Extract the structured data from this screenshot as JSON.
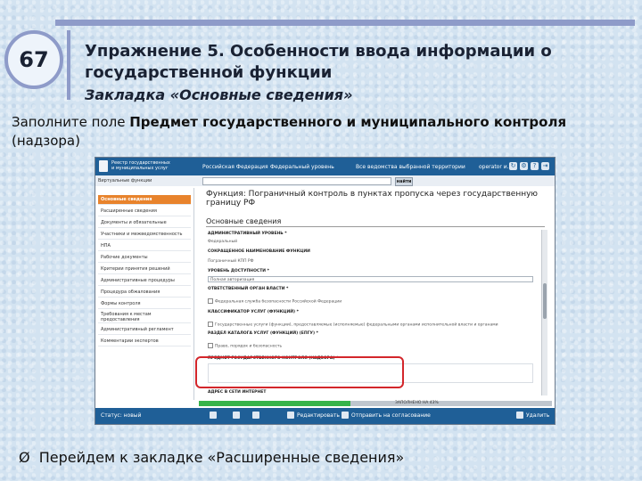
{
  "slide": {
    "number": "67",
    "title": "Упражнение 5. Особенности ввода информации о государственной функции",
    "subtitle": "Закладка «Основные сведения»",
    "instruction_prefix": "Заполните поле ",
    "instruction_bold": "Предмет государственного и муниципального контроля",
    "instruction_suffix": " (надзора)",
    "bullet_marker": "Ø",
    "bullet_text": "Перейдем к закладке «Расширенные сведения»"
  },
  "app": {
    "logo_text": "Реестр государственных и муниципальных услуг",
    "nav": [
      "Российская Федерация",
      "Федеральный уровень",
      "Все ведомства выбранной территории",
      "operator и. о."
    ],
    "search_label": "Виртуальные функции",
    "search_button": "найти",
    "sidebar_items": [
      "Основные сведения",
      "Расширенные сведения",
      "Документы и обязательные",
      "Участники и межведомственность",
      "НПА",
      "Рабочие документы",
      "Критерии принятия решений",
      "Административные процедуры",
      "Процедура обжалования",
      "Формы контроля",
      "Требования к местам предоставления",
      "Административный регламент",
      "Комментарии экспертов"
    ],
    "function_title": "Функция: Пограничный контроль в пунктах пропуска через государственную границу РФ",
    "section_header": "Основные сведения",
    "form": {
      "admin_level_label": "АДМИНИСТРАТИВНЫЙ УРОВЕНЬ *",
      "admin_level_value": "Федеральный",
      "short_name_label": "СОКРАЩЕННОЕ НАИМЕНОВАНИЕ ФУНКЦИИ",
      "short_name_value": "Пограничный КПП РФ",
      "access_level_label": "УРОВЕНЬ ДОСТУПНОСТИ *",
      "access_level_value": "Полная авторизация",
      "authority_label": "ОТВЕТСТВЕННЫЙ ОРГАН ВЛАСТИ *",
      "authority_value": "Федеральная служба безопасности Российской Федерации",
      "classifier_label": "КЛАССИФИКАТОР УСЛУГ (ФУНКЦИЙ) *",
      "classifier_value": "Государственные услуги (функции), предоставляемые (исполняемые) федеральными органами исполнительной власти и органами",
      "catalog_label": "РАЗДЕЛ КАТАЛОГА УСЛУГ (ФУНКЦИЙ) (ЕПГУ) *",
      "catalog_value": "Право, порядок и безопасность",
      "subject_label": "ПРЕДМЕТ ГОСУДАРСТВЕННОГО КОНТРОЛЯ (НАДЗОРА) *",
      "address_label": "АДРЕС В СЕТИ ИНТЕРНЕТ"
    },
    "progress_percent": 43,
    "progress_text": "ЗАПОЛНЕНО НА 43%",
    "status": {
      "state": "Статус: новый",
      "save": "Редактировать",
      "send": "Отправить на согласование",
      "delete": "Удалить"
    }
  },
  "colors": {
    "accent_orange": "#e8832c",
    "header_blue": "#1f5f97",
    "highlight_red": "#d3262b",
    "progress_green": "#36b34a"
  }
}
